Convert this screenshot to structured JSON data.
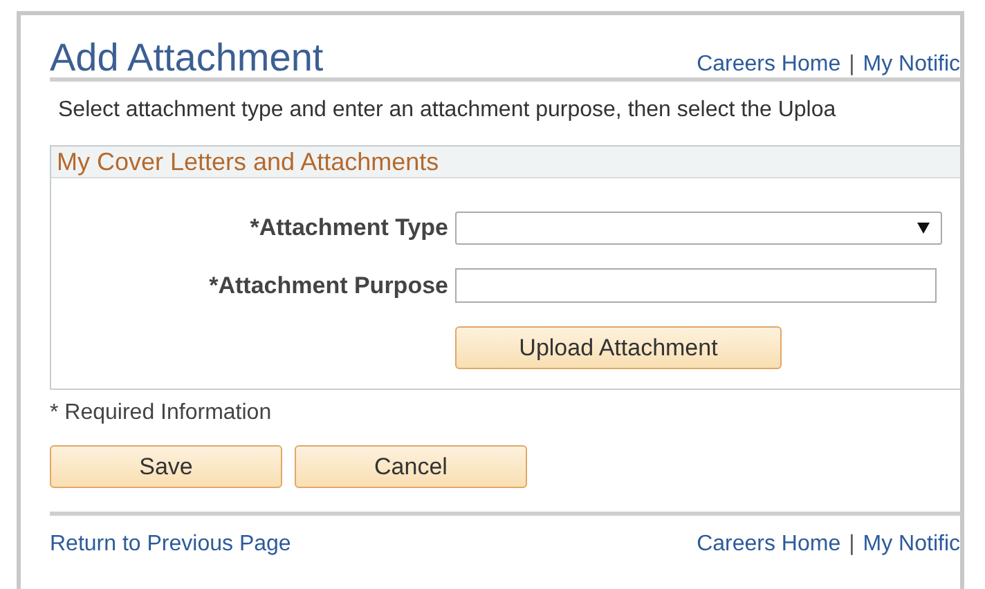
{
  "page": {
    "title": "Add Attachment"
  },
  "header_links": {
    "items": [
      "Careers Home",
      "My Notific"
    ],
    "separator": "|"
  },
  "instructions": "Select attachment type and enter an attachment purpose, then select the Uploa",
  "section": {
    "title": "My Cover Letters and Attachments",
    "fields": [
      {
        "kind": "dropdown",
        "label": "*Attachment Type"
      },
      {
        "kind": "text",
        "label": "*Attachment Purpose"
      }
    ],
    "upload_button": "Upload Attachment"
  },
  "required_note": "* Required Information",
  "buttons": [
    "Save",
    "Cancel"
  ],
  "footer": {
    "back_link": "Return to Previous Page",
    "links": {
      "items": [
        "Careers Home",
        "My Notific"
      ],
      "separator": "|"
    }
  }
}
